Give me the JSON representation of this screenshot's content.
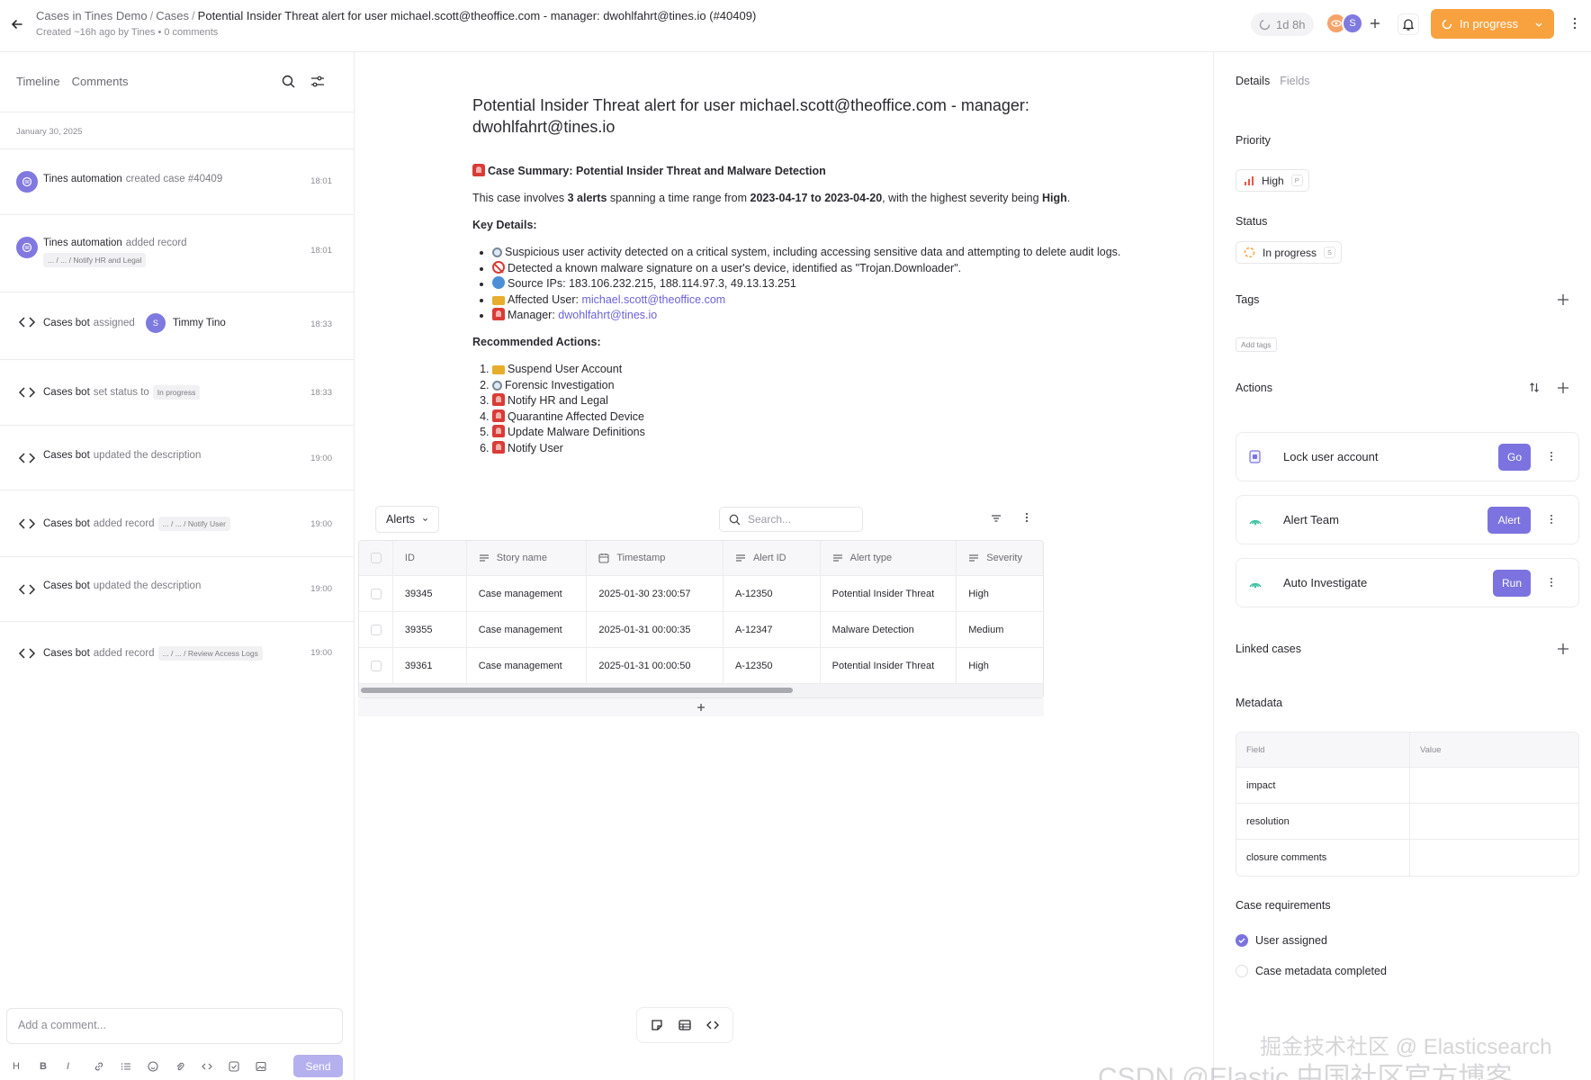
{
  "header": {
    "breadcrumb": {
      "workspace": "Cases in Tines Demo",
      "section": "Cases",
      "current": "Potential Insider Threat alert for user michael.scott@theoffice.com - manager: dwohlfahrt@tines.io (#40409)"
    },
    "meta": "Created ~16h ago by Tines  •  0 comments",
    "timer": "1d 8h",
    "avatar_initial": "S",
    "status_label": "In progress"
  },
  "left_panel": {
    "tabs": [
      "Timeline",
      "Comments"
    ],
    "date": "January 30, 2025",
    "timeline": [
      {
        "actor": "Tines automation",
        "action": "created case #40409",
        "time": "18:01"
      },
      {
        "actor": "Tines automation",
        "action": "added record",
        "chip": "... / ... / Notify HR and Legal",
        "time": "18:01"
      },
      {
        "actor": "Cases bot",
        "action": "assigned",
        "user_initial": "S",
        "user": "Timmy Tino",
        "time": "18:33"
      },
      {
        "actor": "Cases bot",
        "action": "set status to",
        "chip": "In progress",
        "time": "18:33"
      },
      {
        "actor": "Cases bot",
        "action": "updated the description",
        "time": "19:00"
      },
      {
        "actor": "Cases bot",
        "action": "added record",
        "chip": "... / ... / Notify User",
        "time": "19:00"
      },
      {
        "actor": "Cases bot",
        "action": "updated the description",
        "time": "19:00"
      },
      {
        "actor": "Cases bot",
        "action": "added record",
        "chip": "... / ... / Review Access Logs",
        "time": "19:00"
      }
    ],
    "comment_placeholder": "Add a comment...",
    "toolbar_heading": "H",
    "toolbar_bold": "B",
    "toolbar_italic": "I",
    "send_label": "Send"
  },
  "main": {
    "title": "Potential Insider Threat alert for user michael.scott@theoffice.com - manager: dwohlfahrt@tines.io",
    "summary_heading": "Case Summary: Potential Insider Threat and Malware Detection",
    "intro": {
      "t1": "This case involves ",
      "count": "3 alerts",
      "t2": " spanning a time range from ",
      "range": "2023-04-17 to 2023-04-20",
      "t3": ", with the highest severity being ",
      "severity": "High",
      "t4": "."
    },
    "key_details_heading": "Key Details:",
    "key_details": {
      "activity": "Suspicious user activity detected on a critical system, including accessing sensitive data and attempting to delete audit logs.",
      "malware": "Detected a known malware signature on a user's device, identified as \"Trojan.Downloader\".",
      "ips": "Source IPs: 183.106.232.215, 188.114.97.3, 49.13.13.251",
      "user_label": "Affected User: ",
      "user_email": "michael.scott@theoffice.com",
      "manager_label": "Manager: ",
      "manager_email": "dwohlfahrt@tines.io"
    },
    "actions_heading": "Recommended Actions:",
    "recommended_actions": [
      "Suspend User Account",
      "Forensic Investigation",
      "Notify HR and Legal",
      "Quarantine Affected Device",
      "Update Malware Definitions",
      "Notify User"
    ],
    "table": {
      "selector": "Alerts",
      "search_placeholder": "Search...",
      "columns": [
        "ID",
        "Story name",
        "Timestamp",
        "Alert ID",
        "Alert type",
        "Severity"
      ],
      "rows": [
        [
          "39345",
          "Case management",
          "2025-01-30 23:00:57",
          "A-12350",
          "Potential Insider Threat",
          "High"
        ],
        [
          "39355",
          "Case management",
          "2025-01-31 00:00:35",
          "A-12347",
          "Malware Detection",
          "Medium"
        ],
        [
          "39361",
          "Case management",
          "2025-01-31 00:00:50",
          "A-12350",
          "Potential Insider Threat",
          "High"
        ]
      ]
    }
  },
  "right_panel": {
    "tabs": [
      "Details",
      "Fields"
    ],
    "priority_heading": "Priority",
    "priority": {
      "label": "High",
      "key": "P"
    },
    "status_heading": "Status",
    "status": {
      "label": "In progress",
      "key": "S"
    },
    "tags_heading": "Tags",
    "add_tags": "Add tags",
    "actions_heading": "Actions",
    "actions": [
      {
        "name": "Lock user account",
        "button": "Go"
      },
      {
        "name": "Alert Team",
        "button": "Alert"
      },
      {
        "name": "Auto Investigate",
        "button": "Run"
      }
    ],
    "linked_heading": "Linked cases",
    "metadata_heading": "Metadata",
    "metadata_columns": [
      "Field",
      "Value"
    ],
    "metadata": [
      {
        "field": "impact",
        "value": ""
      },
      {
        "field": "resolution",
        "value": ""
      },
      {
        "field": "closure comments",
        "value": ""
      }
    ],
    "requirements_heading": "Case requirements",
    "requirements": [
      {
        "label": "User assigned",
        "done": true
      },
      {
        "label": "Case metadata completed",
        "done": false
      }
    ]
  },
  "watermark": "CSDN @Elastic 中国社区官方博客",
  "watermark_overlay": "掘金技术社区 @ Elasticsearch",
  "colors": {
    "accent": "#7c73e0",
    "status_orange": "#f7a23f",
    "priority_red": "#e8564a"
  }
}
